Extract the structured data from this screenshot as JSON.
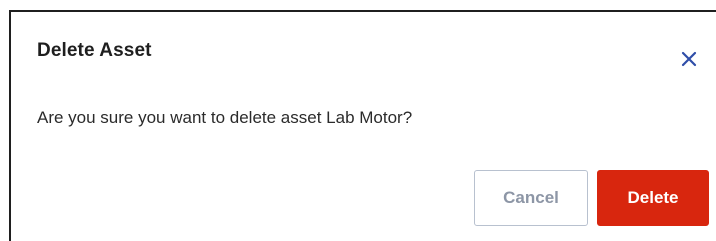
{
  "dialog": {
    "title": "Delete Asset",
    "message": "Are you sure you want to delete asset Lab Motor?",
    "close_icon": "close-icon",
    "buttons": {
      "cancel_label": "Cancel",
      "delete_label": "Delete"
    }
  },
  "colors": {
    "close_icon": "#2f4ea8",
    "delete_button_bg": "#d8260e",
    "cancel_button_border": "#b8c1cf",
    "cancel_button_text": "#8d96a6"
  }
}
